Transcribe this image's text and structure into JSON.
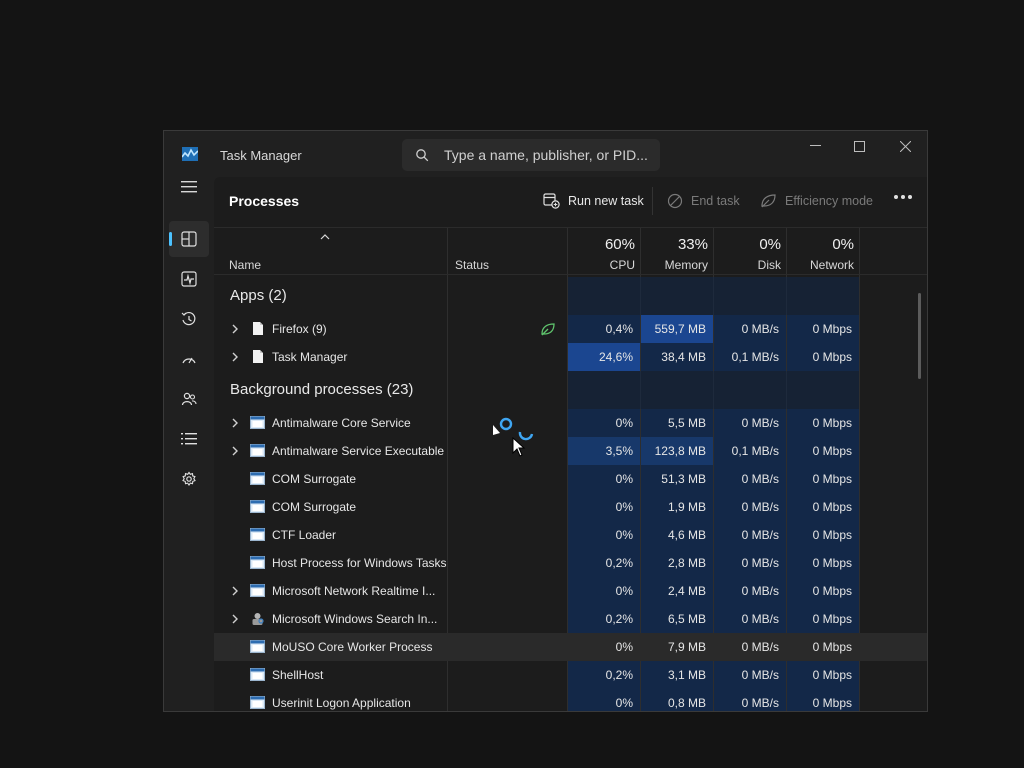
{
  "window": {
    "title": "Task Manager",
    "search_placeholder": "Type a name, publisher, or PID..."
  },
  "sidebar": {
    "items": [
      {
        "name": "processes",
        "icon": "processes-icon",
        "active": true
      },
      {
        "name": "performance",
        "icon": "performance-icon"
      },
      {
        "name": "app-history",
        "icon": "history-icon"
      },
      {
        "name": "startup-apps",
        "icon": "startup-icon"
      },
      {
        "name": "users",
        "icon": "users-icon"
      },
      {
        "name": "details",
        "icon": "details-icon"
      },
      {
        "name": "services",
        "icon": "services-icon"
      }
    ],
    "settings_icon": "gear-icon"
  },
  "toolbar": {
    "page_title": "Processes",
    "run_new_task": "Run new task",
    "end_task": "End task",
    "efficiency_mode": "Efficiency mode"
  },
  "columns": {
    "name": "Name",
    "status": "Status",
    "cpu_pct": "60%",
    "cpu": "CPU",
    "memory_pct": "33%",
    "memory": "Memory",
    "disk_pct": "0%",
    "disk": "Disk",
    "network_pct": "0%",
    "network": "Network"
  },
  "groups": {
    "apps": "Apps (2)",
    "background": "Background processes (23)"
  },
  "apps": [
    {
      "name": "Firefox (9)",
      "icon": "document-icon",
      "expandable": true,
      "status_icon": "leaf-icon",
      "cpu": "0,4%",
      "memory": "559,7 MB",
      "disk": "0 MB/s",
      "network": "0 Mbps",
      "cpu_level": 1,
      "mem_level": 3
    },
    {
      "name": "Task Manager",
      "icon": "document-icon",
      "expandable": true,
      "status_icon": "",
      "cpu": "24,6%",
      "memory": "38,4 MB",
      "disk": "0,1 MB/s",
      "network": "0 Mbps",
      "cpu_level": 3,
      "mem_level": 1
    }
  ],
  "background": [
    {
      "name": "Antimalware Core Service",
      "icon": "window-icon",
      "expandable": true,
      "cpu": "0%",
      "memory": "5,5 MB",
      "disk": "0 MB/s",
      "network": "0 Mbps",
      "cpu_level": 1,
      "mem_level": 1
    },
    {
      "name": "Antimalware Service Executable",
      "icon": "window-icon",
      "expandable": true,
      "cpu": "3,5%",
      "memory": "123,8 MB",
      "disk": "0,1 MB/s",
      "network": "0 Mbps",
      "cpu_level": 2,
      "mem_level": 2
    },
    {
      "name": "COM Surrogate",
      "icon": "window-icon",
      "expandable": false,
      "cpu": "0%",
      "memory": "51,3 MB",
      "disk": "0 MB/s",
      "network": "0 Mbps",
      "cpu_level": 1,
      "mem_level": 1
    },
    {
      "name": "COM Surrogate",
      "icon": "window-icon",
      "expandable": false,
      "cpu": "0%",
      "memory": "1,9 MB",
      "disk": "0 MB/s",
      "network": "0 Mbps",
      "cpu_level": 1,
      "mem_level": 1
    },
    {
      "name": "CTF Loader",
      "icon": "window-icon",
      "expandable": false,
      "cpu": "0%",
      "memory": "4,6 MB",
      "disk": "0 MB/s",
      "network": "0 Mbps",
      "cpu_level": 1,
      "mem_level": 1
    },
    {
      "name": "Host Process for Windows Tasks",
      "icon": "window-icon",
      "expandable": false,
      "cpu": "0,2%",
      "memory": "2,8 MB",
      "disk": "0 MB/s",
      "network": "0 Mbps",
      "cpu_level": 1,
      "mem_level": 1
    },
    {
      "name": "Microsoft Network Realtime I...",
      "icon": "window-icon",
      "expandable": true,
      "cpu": "0%",
      "memory": "2,4 MB",
      "disk": "0 MB/s",
      "network": "0 Mbps",
      "cpu_level": 1,
      "mem_level": 1
    },
    {
      "name": "Microsoft Windows Search In...",
      "icon": "search-indexer-icon",
      "expandable": true,
      "cpu": "0,2%",
      "memory": "6,5 MB",
      "disk": "0 MB/s",
      "network": "0 Mbps",
      "cpu_level": 1,
      "mem_level": 1
    },
    {
      "name": "MoUSO Core Worker Process",
      "icon": "window-icon",
      "expandable": false,
      "cpu": "0%",
      "memory": "7,9 MB",
      "disk": "0 MB/s",
      "network": "0 Mbps",
      "cpu_level": 1,
      "mem_level": 1,
      "hover": true
    },
    {
      "name": "ShellHost",
      "icon": "window-icon",
      "expandable": false,
      "cpu": "0,2%",
      "memory": "3,1 MB",
      "disk": "0 MB/s",
      "network": "0 Mbps",
      "cpu_level": 1,
      "mem_level": 1
    },
    {
      "name": "Userinit Logon Application",
      "icon": "window-icon",
      "expandable": false,
      "cpu": "0%",
      "memory": "0,8 MB",
      "disk": "0 MB/s",
      "network": "0 Mbps",
      "cpu_level": 1,
      "mem_level": 1
    }
  ],
  "colors": {
    "accent": "#4cc2ff",
    "heat_1": "#132848",
    "heat_2": "#17386a",
    "heat_3": "#1b4690"
  }
}
